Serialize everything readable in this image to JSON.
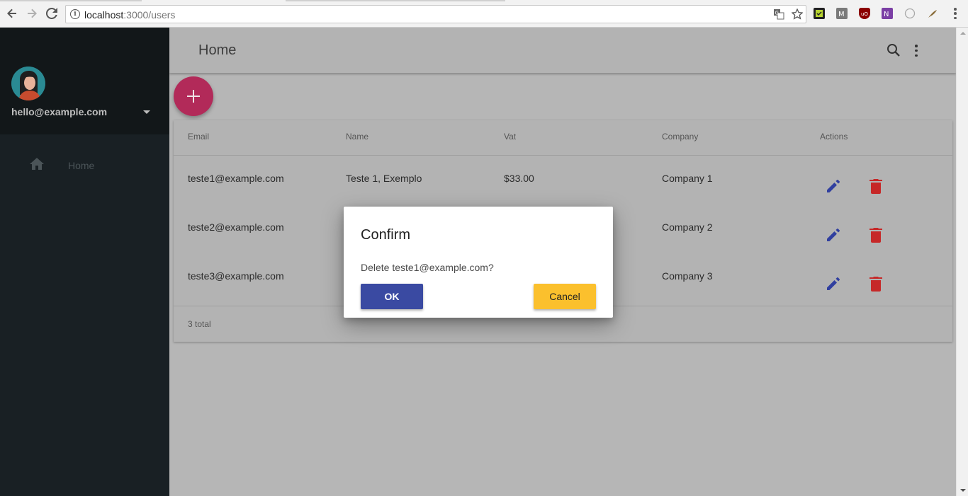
{
  "browser": {
    "url_host": "localhost",
    "url_path": ":3000/users"
  },
  "sidebar": {
    "user_email": "hello@example.com",
    "items": [
      {
        "label": "Home",
        "icon": "home-icon"
      }
    ]
  },
  "appbar": {
    "title": "Home"
  },
  "table": {
    "columns": [
      "Email",
      "Name",
      "Vat",
      "Company",
      "Actions"
    ],
    "rows": [
      {
        "email": "teste1@example.com",
        "name": "Teste 1, Exemplo",
        "vat": "$33.00",
        "company": "Company 1"
      },
      {
        "email": "teste2@example.com",
        "name": "",
        "vat": "",
        "company": "Company 2"
      },
      {
        "email": "teste3@example.com",
        "name": "",
        "vat": "",
        "company": "Company 3"
      }
    ],
    "total": "3 total"
  },
  "dialog": {
    "title": "Confirm",
    "message": "Delete teste1@example.com?",
    "ok_label": "OK",
    "cancel_label": "Cancel"
  },
  "colors": {
    "fab": "#b22a59",
    "edit_icon": "#303f9f",
    "delete_icon": "#c62828",
    "ok_button": "#3a4aa2",
    "cancel_button": "#fbc02d",
    "sidebar": "#192024"
  }
}
